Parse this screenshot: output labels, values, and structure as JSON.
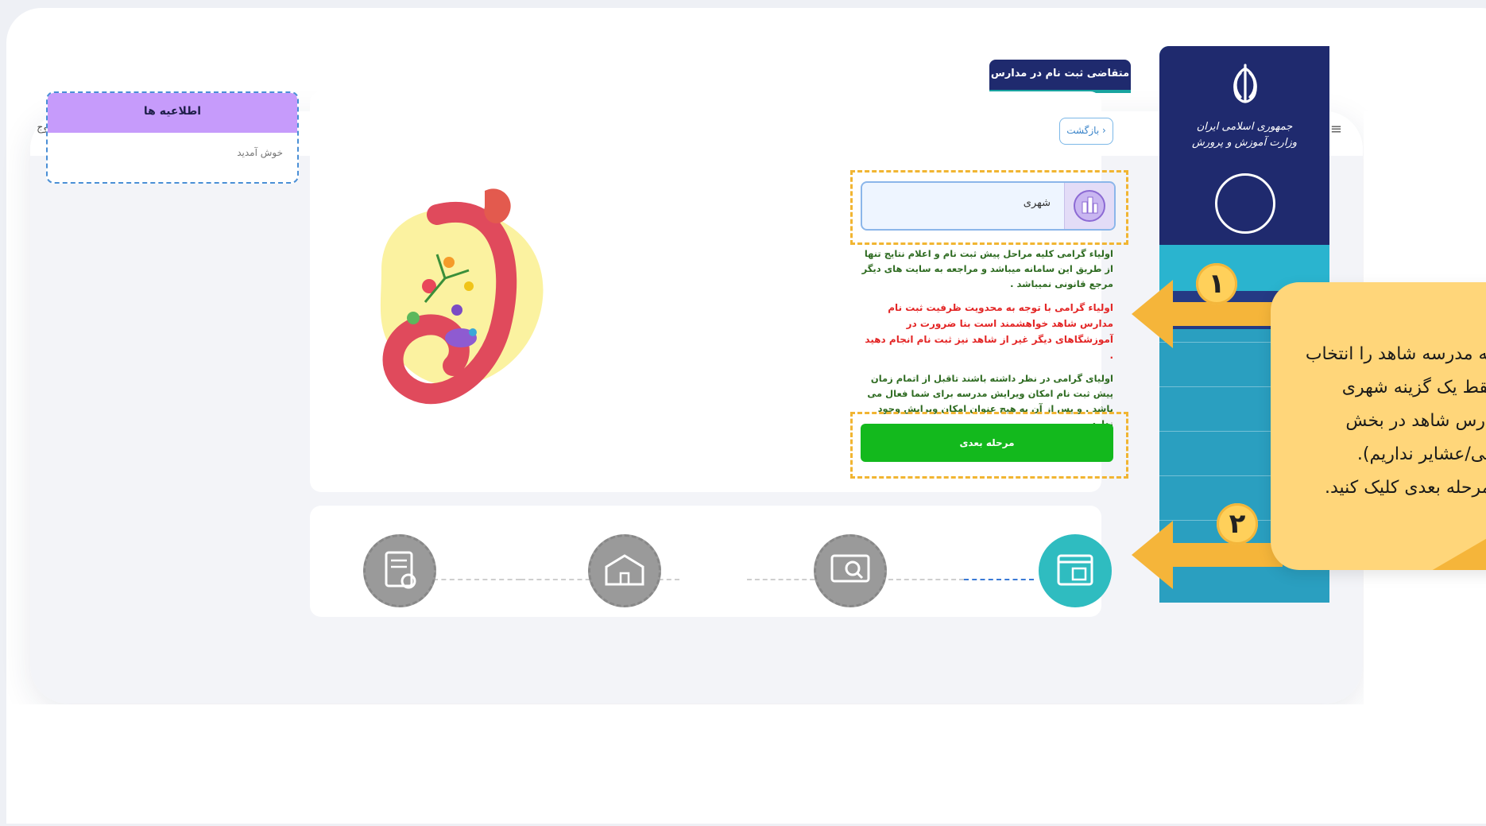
{
  "topbar": {
    "logout_label": "خروج",
    "menu_icon": "menu-icon",
    "logout_icon": "logout-icon"
  },
  "sidebar": {
    "title_line1": "جمهوری اسلامی ایران",
    "title_line2": "وزارت آموزش و پرورش",
    "emblem_icon": "iran-emblem-icon",
    "colors": {
      "dark": "#1f2a6e",
      "light": "#2a9fc0"
    }
  },
  "main": {
    "tab_title": "متقاضی ثبت نام در مدارس",
    "back_label": "بازگشت",
    "select_value": "شهری",
    "select_icon": "city-icon",
    "notes": {
      "green1": "اولیاء گرامی کلیه مراحل پیش ثبت نام و اعلام نتایج تنها از طریق این سامانه میباشد و مراجعه به سایت های دیگر مرجع قانونی نمیباشد .",
      "red": "اولیاء گرامی با توجه به محدویت ظرفیت ثبت نام مدارس شاهد خواهشمند است بنا ضرورت در آموزشگاهای دیگر غیر از شاهد نیز ثبت نام انجام دهید .",
      "green2": "اولیای گرامی در نظر داشته باشند تاقبل از اتمام زمان پیش ثبت نام امکان ویرایش مدرسه برای شما فعال می باشد . و پس از آن به هیچ عنوان امکان ویرایش وجود ندارد."
    },
    "next_label": "مرحله بعدی"
  },
  "notice": {
    "title": "اطلاعیه ها",
    "body": "خوش آمدید"
  },
  "steps": [
    {
      "icon": "browser-form-icon",
      "active": true
    },
    {
      "icon": "search-screen-icon",
      "active": false
    },
    {
      "icon": "school-building-icon",
      "active": false
    },
    {
      "icon": "document-check-icon",
      "active": false
    }
  ],
  "badges": {
    "one": "۱",
    "two": "۲"
  },
  "callout": {
    "lines": [
      "ی که مدرسه شاهد را انتخاب",
      "د. فقط یک گزینه شهری",
      "(مدارس شاهد در بخش",
      "ستایی/عشایر نداریم).",
      "مه مرحله بعدی کلیک کنید."
    ]
  },
  "colors": {
    "accent": "#f1b532",
    "green": "#13b91d",
    "purple": "#c69bfb",
    "callout": "#ffd67a"
  }
}
